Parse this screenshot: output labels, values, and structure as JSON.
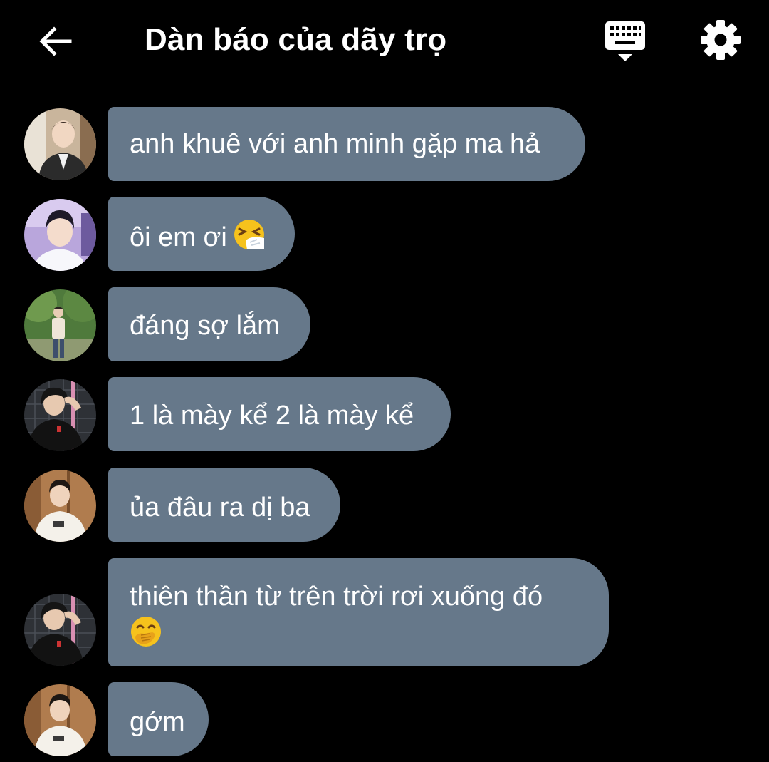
{
  "header": {
    "title": "Dàn báo của dãy trọ",
    "back_icon": "arrow-left-icon",
    "keyboard_icon": "keyboard-icon",
    "settings_icon": "gear-icon"
  },
  "colors": {
    "background": "#000000",
    "bubble": "#66788a",
    "text": "#ffffff"
  },
  "messages": [
    {
      "text": "anh khuê với anh minh gặp ma hả"
    },
    {
      "text": "ôi em ơi",
      "emoji": "sneezing-face-emoji"
    },
    {
      "text": "đáng sợ lắm"
    },
    {
      "text": "1 là mày kể 2 là mày kể"
    },
    {
      "text": "ủa đâu ra dị ba"
    },
    {
      "text": "thiên thần từ trên trời rơi xuống đó",
      "emoji": "face-with-hand-over-mouth-emoji"
    },
    {
      "text": "gớm"
    }
  ]
}
